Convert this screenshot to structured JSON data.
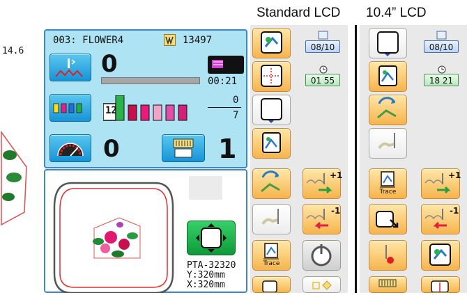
{
  "headers": {
    "standard": "Standard LCD",
    "large": "10.4” LCD"
  },
  "left_edge": {
    "value": "14.6"
  },
  "status": {
    "design_name": "003: FLOWER4",
    "stitch_count": "13497",
    "current_stitch": "0",
    "time": "00:21",
    "color_step": "12",
    "color_progress_top": "0",
    "color_progress_bottom": "7",
    "speed_value": "0",
    "needle_number": "1"
  },
  "hoop": {
    "name": "PTA-32320",
    "y": "Y:320mm",
    "x": "X:320mm"
  },
  "standard_col": {
    "counter1": "08/10",
    "counter2": "01 55",
    "trace_label": "Trace",
    "step_fwd": "+1",
    "step_back": "-1"
  },
  "large_col": {
    "counter1": "08/10",
    "counter2": "18 21",
    "trace_label": "Trace",
    "step_fwd": "+1",
    "step_back": "-1"
  },
  "icons": {
    "needle_icon": "needle-icon",
    "thread_icon": "thread-spool-icon",
    "speed_icon": "speedometer-icon",
    "frame_icon": "frame-move-icon",
    "power_icon": "power-icon",
    "trace_icon": "trace-icon"
  },
  "colors": {
    "accent": "#1894d6",
    "panel": "#aee3f3",
    "orange": "#f6b44d",
    "black_box": "#111111"
  }
}
